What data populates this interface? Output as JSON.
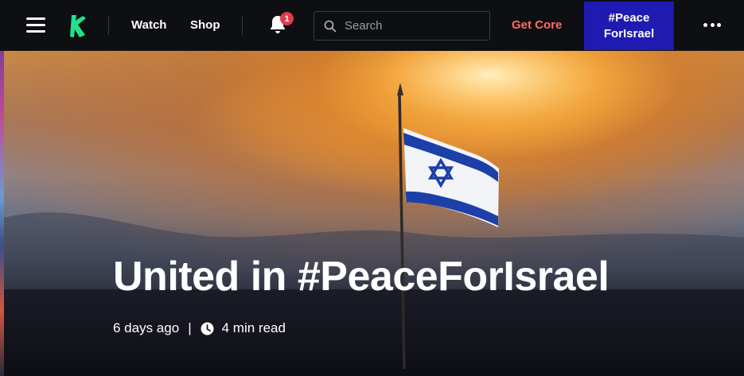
{
  "nav": {
    "menu_icon": "hamburger-menu-icon",
    "logo_icon": "kotaku-logo-icon",
    "links": [
      {
        "label": "Watch"
      },
      {
        "label": "Shop"
      }
    ],
    "notifications": {
      "icon": "bell-icon",
      "count": "1"
    },
    "search": {
      "placeholder": "Search",
      "value": "",
      "icon": "search-icon"
    },
    "get_core_label": "Get Core",
    "campaign_button": {
      "line1": "#Peace",
      "line2": "ForIsrael"
    },
    "more_icon": "more-dots-icon"
  },
  "hero": {
    "title": "United in #PeaceForIsrael",
    "posted": "6 days ago",
    "separator": "|",
    "clock_icon": "clock-icon",
    "read_time": "4 min read"
  },
  "colors": {
    "topbar_bg": "#0e0f13",
    "get_core": "#ff6d5f",
    "campaign_bg": "#1f1ab0",
    "badge": "#e03b4b",
    "logo": "#1ee38a",
    "flag_blue": "#1d3fa8"
  }
}
